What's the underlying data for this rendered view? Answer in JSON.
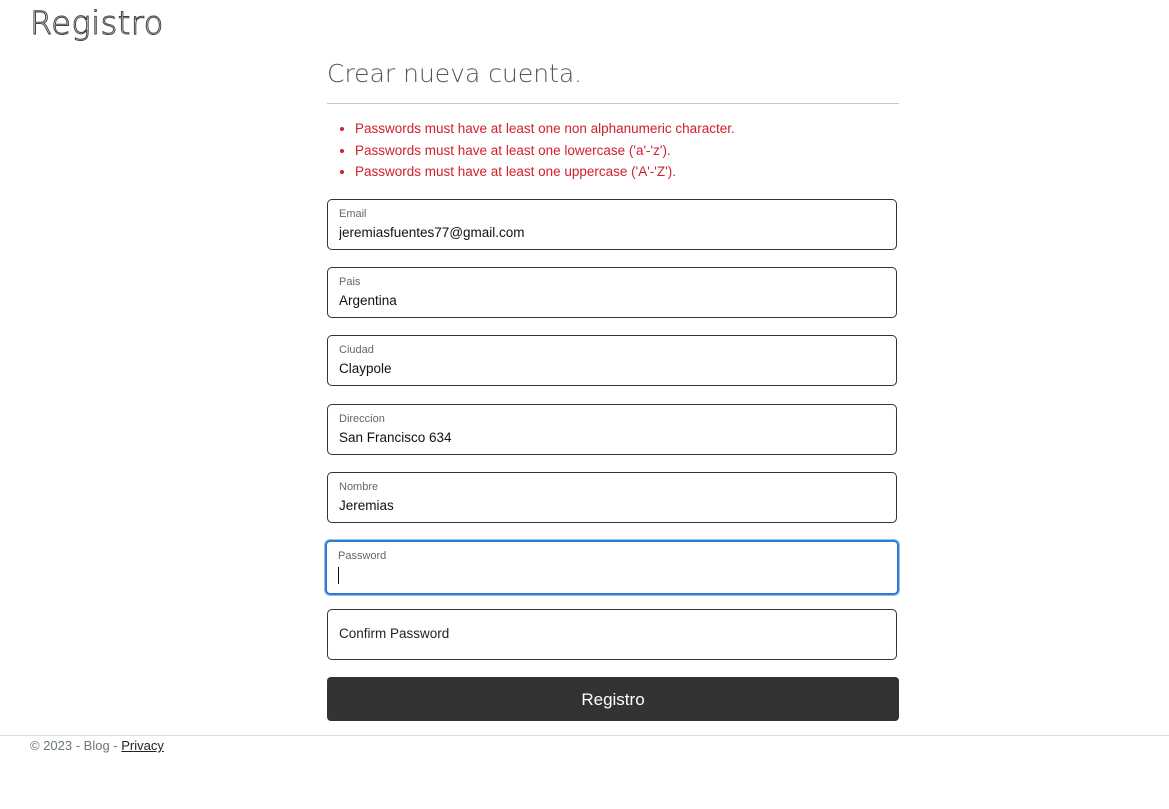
{
  "header": {
    "title": "Registro"
  },
  "form": {
    "heading": "Crear nueva cuenta.",
    "errors": [
      "Passwords must have at least one non alphanumeric character.",
      "Passwords must have at least one lowercase ('a'-'z').",
      "Passwords must have at least one uppercase ('A'-'Z')."
    ],
    "fields": {
      "email": {
        "label": "Email",
        "value": "jeremiasfuentes77@gmail.com"
      },
      "pais": {
        "label": "Pais",
        "value": "Argentina"
      },
      "ciudad": {
        "label": "Ciudad",
        "value": "Claypole"
      },
      "direccion": {
        "label": "Direccion",
        "value": "San Francisco 634"
      },
      "nombre": {
        "label": "Nombre",
        "value": "Jeremias"
      },
      "password": {
        "label": "Password",
        "value": ""
      },
      "confirm_password": {
        "label": "Confirm Password",
        "value": ""
      }
    },
    "submit_label": "Registro",
    "focus_color": "#2e7bd6",
    "error_color": "#d0202c"
  },
  "footer": {
    "text": "© 2023 - Blog - ",
    "privacy_link": "Privacy"
  }
}
